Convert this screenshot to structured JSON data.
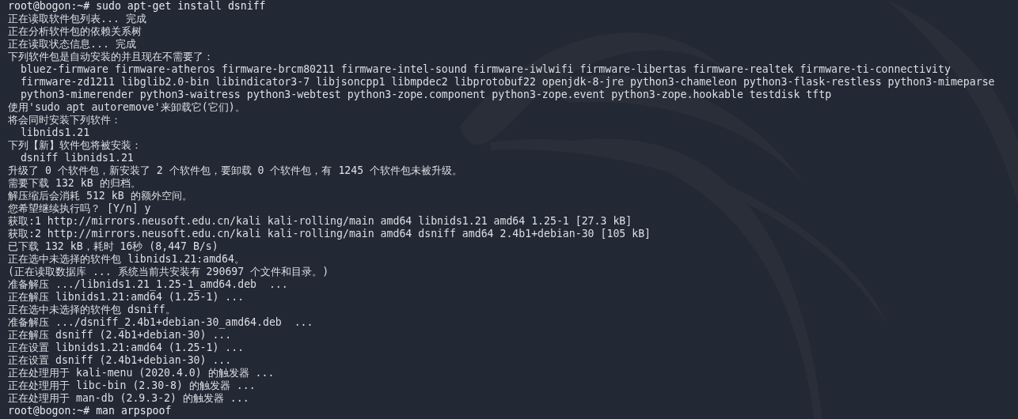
{
  "terminal": {
    "lines": [
      {
        "kind": "command",
        "text": "root@bogon:~# sudo apt-get install dsniff"
      },
      {
        "kind": "output",
        "text": "正在读取软件包列表... 完成"
      },
      {
        "kind": "output",
        "text": "正在分析软件包的依赖关系树"
      },
      {
        "kind": "output",
        "text": "正在读取状态信息... 完成"
      },
      {
        "kind": "output",
        "text": "下列软件包是自动安装的并且现在不需要了："
      },
      {
        "kind": "output",
        "text": "  bluez-firmware firmware-atheros firmware-brcm80211 firmware-intel-sound firmware-iwlwifi firmware-libertas firmware-realtek firmware-ti-connectivity"
      },
      {
        "kind": "output",
        "text": "  firmware-zd1211 libglib2.0-bin libindicator3-7 libjsoncpp1 libmpdec2 libprotobuf22 openjdk-8-jre python3-chameleon python3-flask-restless python3-mimeparse"
      },
      {
        "kind": "output",
        "text": "  python3-mimerender python3-waitress python3-webtest python3-zope.component python3-zope.event python3-zope.hookable testdisk tftp"
      },
      {
        "kind": "output",
        "text": "使用'sudo apt autoremove'来卸载它(它们)。"
      },
      {
        "kind": "output",
        "text": "将会同时安装下列软件："
      },
      {
        "kind": "output",
        "text": "  libnids1.21"
      },
      {
        "kind": "output",
        "text": "下列【新】软件包将被安装："
      },
      {
        "kind": "output",
        "text": "  dsniff libnids1.21"
      },
      {
        "kind": "output",
        "text": "升级了 0 个软件包，新安装了 2 个软件包，要卸载 0 个软件包，有 1245 个软件包未被升级。"
      },
      {
        "kind": "output",
        "text": "需要下载 132 kB 的归档。"
      },
      {
        "kind": "output",
        "text": "解压缩后会消耗 512 kB 的额外空间。"
      },
      {
        "kind": "output",
        "text": "您希望继续执行吗？ [Y/n] y"
      },
      {
        "kind": "output",
        "text": "获取:1 http://mirrors.neusoft.edu.cn/kali kali-rolling/main amd64 libnids1.21 amd64 1.25-1 [27.3 kB]"
      },
      {
        "kind": "output",
        "text": "获取:2 http://mirrors.neusoft.edu.cn/kali kali-rolling/main amd64 dsniff amd64 2.4b1+debian-30 [105 kB]"
      },
      {
        "kind": "output",
        "text": "已下载 132 kB，耗时 16秒 (8,447 B/s)"
      },
      {
        "kind": "output",
        "text": "正在选中未选择的软件包 libnids1.21:amd64。"
      },
      {
        "kind": "output",
        "text": "(正在读取数据库 ... 系统当前共安装有 290697 个文件和目录。)"
      },
      {
        "kind": "output",
        "text": "准备解压 .../libnids1.21_1.25-1_amd64.deb  ..."
      },
      {
        "kind": "output",
        "text": "正在解压 libnids1.21:amd64 (1.25-1) ..."
      },
      {
        "kind": "output",
        "text": "正在选中未选择的软件包 dsniff。"
      },
      {
        "kind": "output",
        "text": "准备解压 .../dsniff_2.4b1+debian-30_amd64.deb  ..."
      },
      {
        "kind": "output",
        "text": "正在解压 dsniff (2.4b1+debian-30) ..."
      },
      {
        "kind": "output",
        "text": "正在设置 libnids1.21:amd64 (1.25-1) ..."
      },
      {
        "kind": "output",
        "text": "正在设置 dsniff (2.4b1+debian-30) ..."
      },
      {
        "kind": "output",
        "text": "正在处理用于 kali-menu (2020.4.0) 的触发器 ..."
      },
      {
        "kind": "output",
        "text": "正在处理用于 libc-bin (2.30-8) 的触发器 ..."
      },
      {
        "kind": "output",
        "text": "正在处理用于 man-db (2.9.3-2) 的触发器 ..."
      },
      {
        "kind": "command",
        "text": "root@bogon:~# man arpspoof"
      }
    ]
  }
}
